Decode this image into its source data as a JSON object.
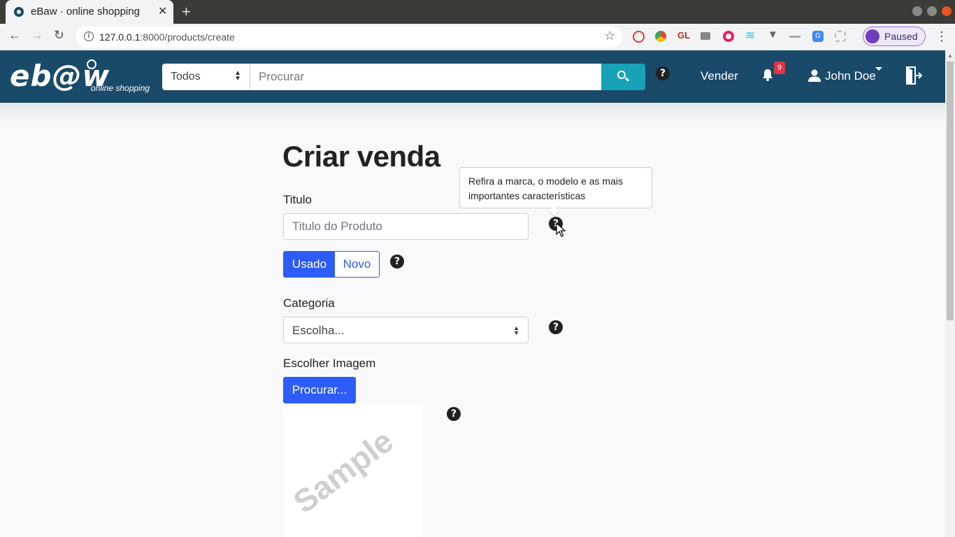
{
  "browser": {
    "tab_title": "eBaw · online shopping",
    "new_tab": "+",
    "url_host": "127.0.0.1",
    "url_rest": ":8000/products/create",
    "profile_status": "Paused",
    "extensions": [
      "privacy-badger-icon",
      "chrome-icon",
      "grammarly-gl-icon",
      "camera-icon",
      "record-icon",
      "wave-icon",
      "vue-devtools-icon",
      "minus-icon",
      "translate-icon",
      "puzzle-icon"
    ]
  },
  "header": {
    "logo_text": "eb@w",
    "logo_sub": "online shopping",
    "category_select": "Todos",
    "search_placeholder": "Procurar",
    "sell_link": "Vender",
    "notifications_count": "9",
    "user_name": "John Doe",
    "accent_color": "#1a4a6a",
    "search_button_color": "#17a2b8"
  },
  "form": {
    "title": "Criar venda",
    "titulo_label": "Titulo",
    "titulo_placeholder": "Titulo do Produto",
    "tooltip_text": "Refira a marca, o modelo e as mais importantes características",
    "condition_options": [
      "Usado",
      "Novo"
    ],
    "condition_selected": "Usado",
    "categoria_label": "Categoria",
    "categoria_value": "Escolha...",
    "imagem_label": "Escolher Imagem",
    "browse_button": "Procurar...",
    "preview_text": "Sample",
    "help_glyph": "?",
    "primary_color": "#2d5cf6"
  }
}
